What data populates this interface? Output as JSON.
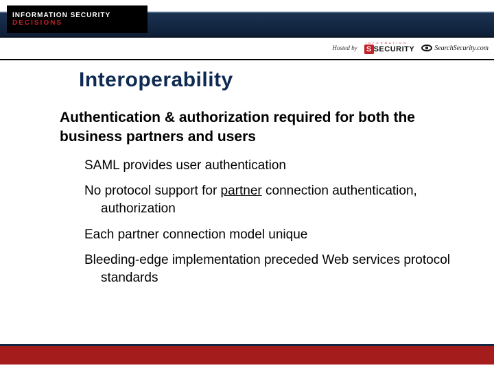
{
  "brand": {
    "line_white": "INFORMATION SECURITY",
    "line_red": "DECISIONS"
  },
  "hosted_by": "Hosted by",
  "logos": {
    "security_tag": "I N F O R M A T I O N",
    "security_text": "SECURITY",
    "searchsec_text": "SearchSecurity.com"
  },
  "title": "Interoperability",
  "lead": "Authentication & authorization required for both the business partners and users",
  "bullets": [
    {
      "pre": "SAML provides user authentication",
      "u": "",
      "post": ""
    },
    {
      "pre": "No protocol support for ",
      "u": "partner",
      "post": " connection authentication, authorization"
    },
    {
      "pre": "Each partner connection model unique",
      "u": "",
      "post": ""
    },
    {
      "pre": "Bleeding-edge implementation preceded Web services protocol standards",
      "u": "",
      "post": ""
    }
  ]
}
